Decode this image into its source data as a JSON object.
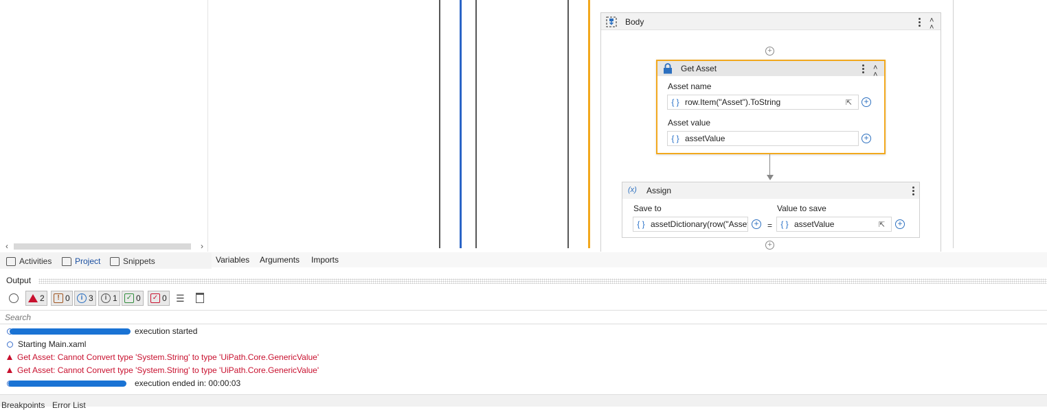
{
  "left_panel": {
    "tabs": [
      {
        "label": "Activities",
        "icon": "activities-icon"
      },
      {
        "label": "Project",
        "icon": "folder-icon",
        "active": true
      },
      {
        "label": "Snippets",
        "icon": "snippets-icon"
      }
    ]
  },
  "designer": {
    "tabs": [
      "Variables",
      "Arguments",
      "Imports"
    ],
    "body": {
      "title": "Body"
    },
    "get_asset": {
      "title": "Get Asset",
      "asset_name_label": "Asset name",
      "asset_name_value": "row.Item(\"Asset\").ToString",
      "asset_value_label": "Asset value",
      "asset_value_value": "assetValue"
    },
    "assign": {
      "title": "Assign",
      "icon_text": "(x)",
      "save_to_label": "Save to",
      "save_to_value": "assetDictionary(row(\"Asset",
      "value_to_save_label": "Value to save",
      "value_to_save_value": "assetValue",
      "equals": "="
    },
    "brace": "{ }"
  },
  "output": {
    "title": "Output",
    "filters": {
      "errors": "2",
      "warnings": "0",
      "info": "3",
      "trace": "1",
      "success": "0",
      "verbose": "0"
    },
    "search_placeholder": "Search",
    "logs": [
      {
        "text": "execution started",
        "level": "info"
      },
      {
        "text": "Starting Main.xaml",
        "level": "info"
      },
      {
        "text": "Get Asset: Cannot Convert type 'System.String' to type 'UiPath.Core.GenericValue'",
        "level": "error"
      },
      {
        "text": "Get Asset: Cannot Convert type 'System.String' to type 'UiPath.Core.GenericValue'",
        "level": "error"
      },
      {
        "text": "execution ended in: 00:00:03",
        "level": "info"
      }
    ]
  },
  "bottom_tabs": [
    "Breakpoints",
    "Error List"
  ],
  "colors": {
    "accent_orange": "#f2a81d",
    "error_red": "#c8102e",
    "link_blue": "#2b73c9"
  }
}
